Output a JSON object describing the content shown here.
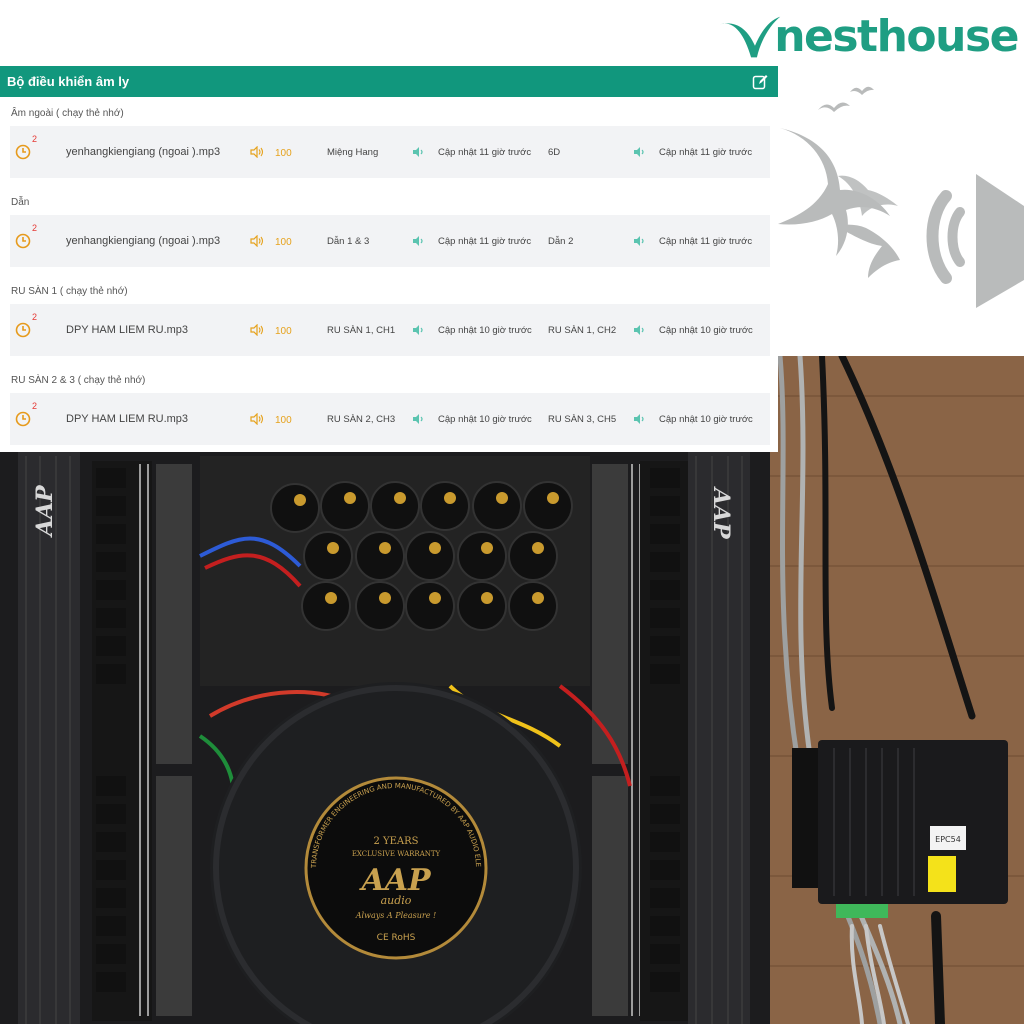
{
  "brand": {
    "name": "nesthouse",
    "color": "#1f9e83"
  },
  "panel": {
    "title": "Bộ điều khiển âm ly",
    "header_color": "#11977d",
    "edit_icon": "edit-icon",
    "groups": [
      {
        "label": "Âm ngoài ( chạy thẻ nhớ)",
        "badge": "2",
        "track": "yenhangkiengiang (ngoai ).mp3",
        "volume": "100",
        "zone1": "Miệng Hang",
        "update1": "Cập nhật 11 giờ trước",
        "zone2": "6D",
        "update2": "Cập nhật 11 giờ trước"
      },
      {
        "label": "Dẫn",
        "badge": "2",
        "track": "yenhangkiengiang (ngoai ).mp3",
        "volume": "100",
        "zone1": "Dẫn 1 & 3",
        "update1": "Cập nhật 11 giờ trước",
        "zone2": "Dẫn 2",
        "update2": "Cập nhật 11 giờ trước"
      },
      {
        "label": "RU SÀN 1 ( chạy thẻ nhớ)",
        "badge": "2",
        "track": "DPY HAM LIEM RU.mp3",
        "volume": "100",
        "zone1": "RU SÀN 1, CH1",
        "update1": "Cập nhật 10 giờ trước",
        "zone2": "RU SÀN 1, CH2",
        "update2": "Cập nhật 10 giờ trước"
      },
      {
        "label": "RU SÀN 2 & 3 ( chạy thẻ nhớ)",
        "badge": "2",
        "track": "DPY HAM LIEM RU.mp3",
        "volume": "100",
        "zone1": "RU SÀN 2, CH3",
        "update1": "Cập nhật 10 giờ trước",
        "zone2": "RU SÀN 3, CH5",
        "update2": "Cập nhật 10 giờ trước"
      }
    ]
  },
  "amplifier": {
    "brand_small": "AAP",
    "brand_sub": "audio",
    "toroid_top": "2 YEARS",
    "toroid_warranty": "EXCLUSIVE WARRANTY",
    "toroid_brand": "AAP",
    "toroid_sub": "audio",
    "toroid_slogan": "Always A Pleasure !",
    "toroid_marks": "CE RoHS",
    "toroid_ring": "TRANSFORMER ENGINEERING AND MANUFACTURED BY AAP AUDIO ELECTRIC CO.,LTD SUPER TOROIDAL POWER",
    "device_label": "EPC54"
  }
}
